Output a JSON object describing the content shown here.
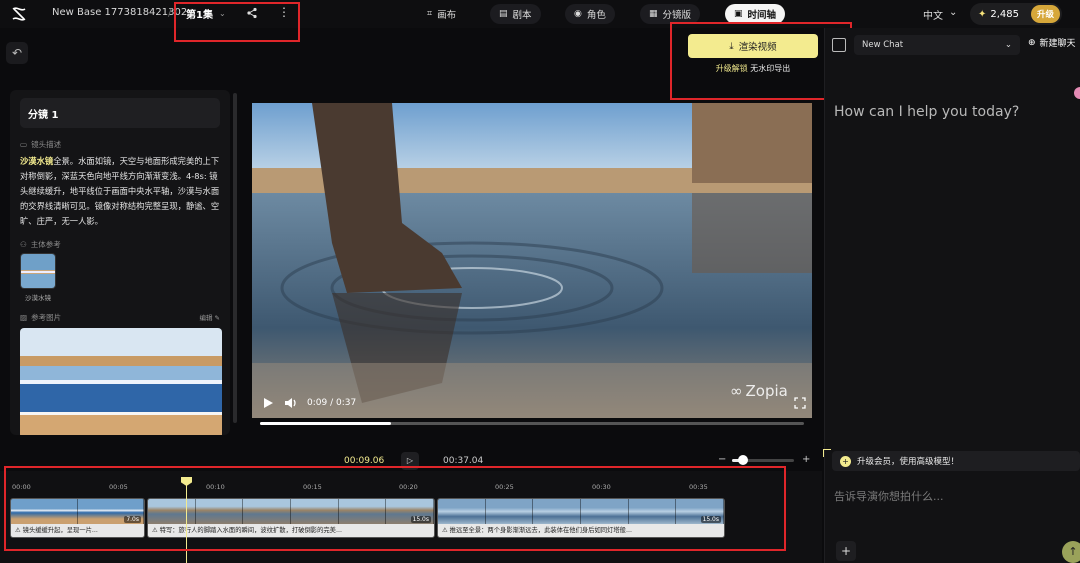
{
  "header": {
    "project_title": "New Base 1773818421302",
    "separator": "/",
    "episode": "第1集",
    "tabs": [
      {
        "label": "画布",
        "icon": "canvas-icon"
      },
      {
        "label": "剧本",
        "icon": "script-icon"
      },
      {
        "label": "角色",
        "icon": "character-icon"
      },
      {
        "label": "分镜版",
        "icon": "storyboard-icon"
      },
      {
        "label": "时间轴",
        "icon": "timeline-icon",
        "active": true
      }
    ],
    "language": "中文",
    "credits": "2,485",
    "upgrade": "升级"
  },
  "render": {
    "button_label": "渲染视频",
    "sub_highlight": "升级解锁",
    "sub_rest": " 无水印导出"
  },
  "shot": {
    "title": "分镜 1",
    "desc_label": "镜头描述",
    "desc_highlight": "沙漠水镜",
    "desc_rest": "全景。水面如镜，天空与地面形成完美的上下对称倒影，深蓝天色向地平线方向渐渐变浅。4-8s: 镜头继续缓升，地平线位于画面中央水平轴，沙漠与水面的交界线清晰可见。镜像对称结构完整呈现，静谧、空旷、庄严，无一人影。",
    "subject_label": "主体参考",
    "subject_name": "沙漠水镜",
    "ref_label": "参考图片",
    "edit_label": "编辑"
  },
  "player": {
    "time": "0:09 / 0:37",
    "progress": 0.24,
    "watermark": "Zopia"
  },
  "timeline": {
    "current": "00:09.06",
    "total": "00:37.04",
    "zoom": 0.18,
    "ruler": [
      "00:00",
      "00:05",
      "00:10",
      "00:15",
      "00:20",
      "00:25",
      "00:30",
      "00:35"
    ],
    "clips": [
      {
        "caption": "⚠ 镜头缓缓升起，呈现一片...",
        "duration": "7.0s"
      },
      {
        "caption": "⚠ 特写：旅行人的脚踏入水面的瞬间，波纹扩散，打破倒影的完美...",
        "duration": "15.0s"
      },
      {
        "caption": "⚠ 推远至全景：两个身影渐渐远去，此装体在他们身后如同灯塔般...",
        "duration": "15.0s"
      }
    ]
  },
  "chat": {
    "selector": "New Chat",
    "new_chat": "新建聊天",
    "greeting": "How can I help you today?",
    "vip_bar": "升级会员，使用高级模型！",
    "input_placeholder": "告诉导演你想拍什么...",
    "add": "+",
    "send": "↑"
  },
  "colors": {
    "accent": "#f3eb8f",
    "annotation": "#e0262a",
    "background": "#0b0b0d"
  }
}
